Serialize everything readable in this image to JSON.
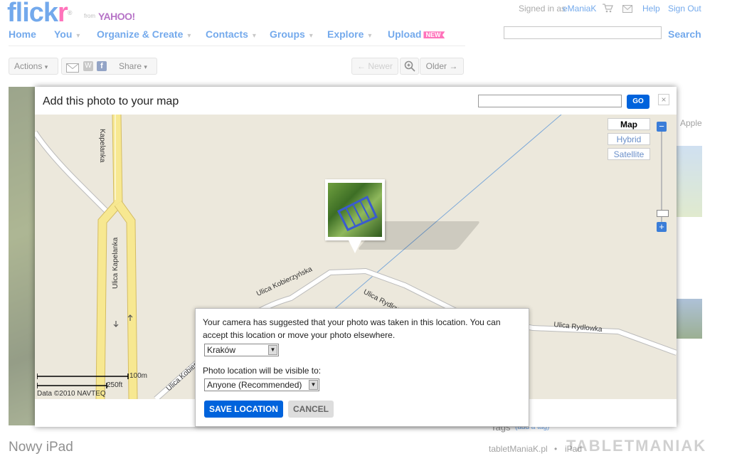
{
  "header": {
    "logo_main": "flick",
    "logo_accent": "r",
    "logo_reg": "®",
    "from_text": "from",
    "yahoo_text": "YAHOO!",
    "signed_in_prefix": "Signed in as",
    "username": "eManiaK",
    "help": "Help",
    "sign_out": "Sign Out",
    "nav": [
      "Home",
      "You",
      "Organize & Create",
      "Contacts",
      "Groups",
      "Explore",
      "Upload"
    ],
    "new_badge": "NEW",
    "search_button": "Search"
  },
  "toolbar": {
    "actions": "Actions",
    "share": "Share",
    "newer": "← Newer",
    "older": "Older →"
  },
  "photo": {
    "title": "Nowy iPad"
  },
  "sidebar": {
    "apple_text": "Apple",
    "tags_label": "Tags",
    "add_tag": "(add a tag)",
    "tag_owner": "tabletManiaK.pl",
    "tag_bullet": "•",
    "tag_value": "iPad"
  },
  "dialog": {
    "title": "Add this photo to your map",
    "go": "GO",
    "close": "×"
  },
  "map": {
    "types": [
      "Map",
      "Hybrid",
      "Satellite"
    ],
    "zoom_plus": "+",
    "zoom_minus": "−",
    "streets": {
      "kapelanka_vertical": "Ulica Kapelanka",
      "kapelanka_top": "Kapelanka",
      "kobierzynska": "Ulica Kobierzyńska",
      "rydlowka_short": "Ulica Rydlowka",
      "rydlowka_long": "Ulica Rydlowka",
      "kobierz_short": "Ulica Kobierz"
    },
    "scale_m": "100m",
    "scale_ft": "250ft",
    "copyright": "Data ©2010 NAVTEQ"
  },
  "popup": {
    "suggest_line1": "Your camera has suggested that your photo was taken in this location. You can",
    "suggest_line2": "accept this location or move your photo elsewhere.",
    "location_value": "Kraków",
    "visibility_label": "Photo location will be visible to:",
    "visibility_value": "Anyone (Recommended)",
    "save": "SAVE LOCATION",
    "cancel": "CANCEL"
  },
  "watermark": "TABLETMANIAK"
}
